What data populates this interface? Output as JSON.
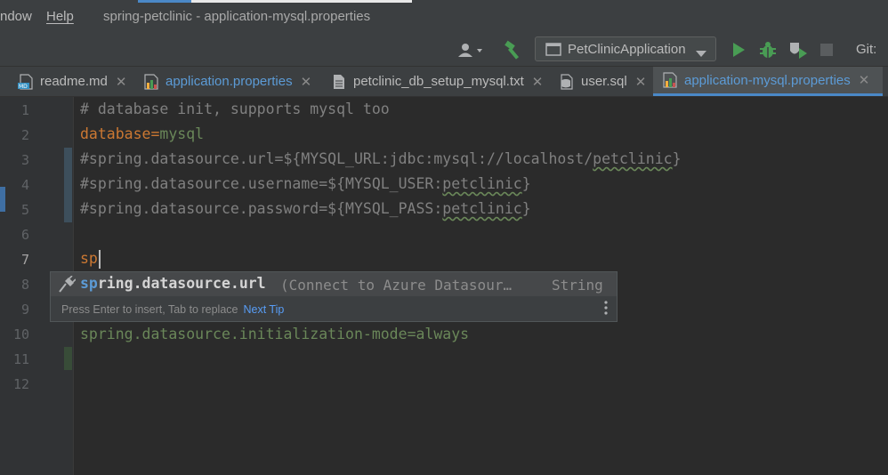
{
  "titlebar": {
    "menu_window": "ndow",
    "menu_help": "Help",
    "title": "spring-petclinic - application-mysql.properties"
  },
  "toolbar": {
    "run_config": "PetClinicApplication",
    "git_label": "Git:"
  },
  "tabs": [
    {
      "label": "readme.md",
      "icon": "markdown-file-icon"
    },
    {
      "label": "application.properties",
      "icon": "properties-file-icon"
    },
    {
      "label": "petclinic_db_setup_mysql.txt",
      "icon": "text-file-icon"
    },
    {
      "label": "user.sql",
      "icon": "sql-file-icon"
    },
    {
      "label": "application-mysql.properties",
      "icon": "properties-file-icon",
      "active": true
    }
  ],
  "editor": {
    "line_numbers": [
      "1",
      "2",
      "3",
      "4",
      "5",
      "6",
      "7",
      "8",
      "9",
      "10",
      "11",
      "12"
    ],
    "lines": {
      "l1": "# database init, supports mysql too",
      "l2_key": "database",
      "l2_eq": "=",
      "l2_val": "mysql",
      "l3_a": "#spring.datasource.url=${MYSQL_URL:jdbc:mysql://localhost/",
      "l3_b": "petclinic",
      "l3_c": "}",
      "l4_a": "#spring.datasource.username=${MYSQL_USER:",
      "l4_b": "petclinic",
      "l4_c": "}",
      "l5_a": "#spring.datasource.password=${MYSQL_PASS:",
      "l5_b": "petclinic",
      "l5_c": "}",
      "l7": "sp",
      "l10_key": "spring.datasource.initialization-mode",
      "l10_eq": "=",
      "l10_val": "always"
    }
  },
  "completion": {
    "match": "sp",
    "rest": "ring.datasource.url",
    "hint": "(Connect to Azure Datasour…",
    "type": "String",
    "footer": "Press Enter to insert, Tab to replace",
    "next_tip": "Next Tip"
  },
  "colors": {
    "accent_blue": "#4a88c7",
    "key_orange": "#cc7832",
    "value_green": "#6a8759",
    "run_green": "#499c54"
  }
}
